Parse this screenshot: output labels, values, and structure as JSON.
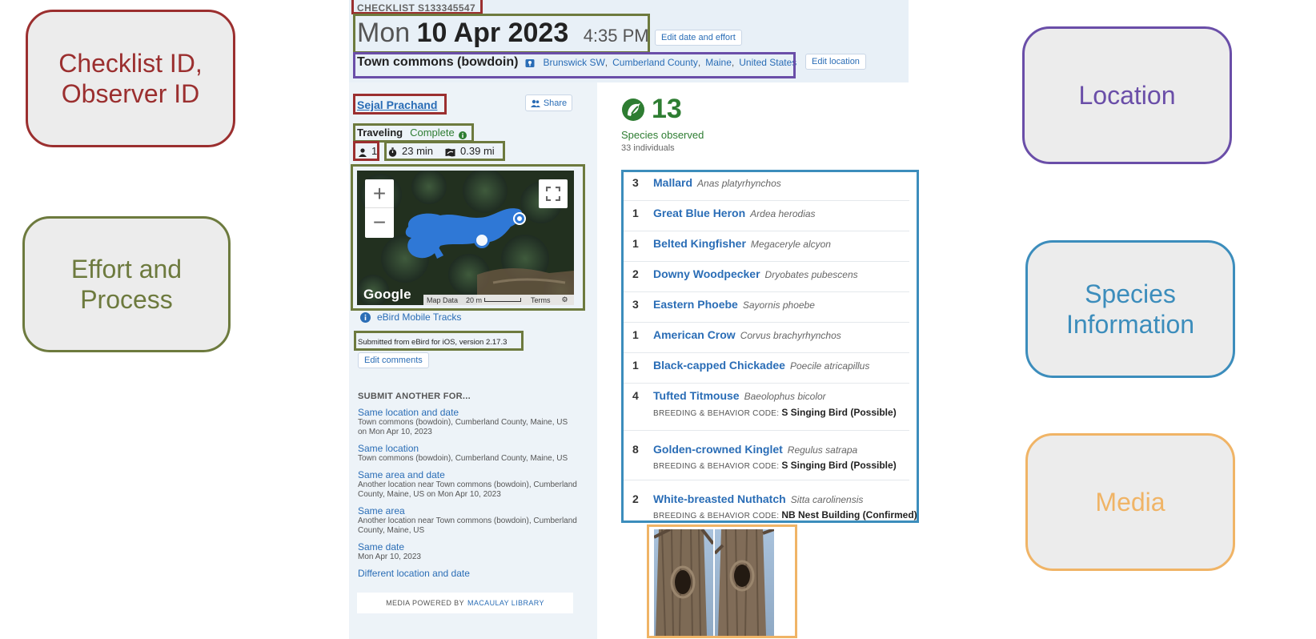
{
  "legend": {
    "checklist": "Checklist ID,\nObserver ID",
    "effort": "Effort and\nProcess",
    "location": "Location",
    "species": "Species\nInformation",
    "media": "Media"
  },
  "header": {
    "checklist_id": "CHECKLIST S133345547",
    "day": "Mon",
    "date": "10 Apr 2023",
    "time": "4:35 PM",
    "edit_date_label": "Edit date and effort",
    "location_name": "Town commons (bowdoin)",
    "location_parts": [
      "Brunswick SW",
      "Cumberland County",
      "Maine",
      "United States"
    ],
    "edit_location_label": "Edit location"
  },
  "sidebar": {
    "observer": "Sejal Prachand",
    "share_label": "Share",
    "protocol": "Traveling",
    "status": "Complete",
    "observers": "1",
    "duration": "23 min",
    "distance": "0.39 mi",
    "map": {
      "attribution": "Google",
      "map_data": "Map Data",
      "scale": "20 m",
      "terms": "Terms",
      "zoom_in": "+",
      "zoom_out": "−"
    },
    "tracks_label": "eBird Mobile Tracks",
    "submitted": "Submitted from eBird for iOS, version 2.17.3",
    "edit_comments_label": "Edit comments",
    "submit_another_title": "SUBMIT ANOTHER FOR...",
    "submit_another": [
      {
        "title": "Same location and date",
        "desc": "Town commons (bowdoin), Cumberland County, Maine, US on Mon Apr 10, 2023"
      },
      {
        "title": "Same location",
        "desc": "Town commons (bowdoin), Cumberland County, Maine, US"
      },
      {
        "title": "Same area and date",
        "desc": "Another location near Town commons (bowdoin), Cumberland County, Maine, US on Mon Apr 10, 2023"
      },
      {
        "title": "Same area",
        "desc": "Another location near Town commons (bowdoin), Cumberland County, Maine, US"
      },
      {
        "title": "Same date",
        "desc": "Mon Apr 10, 2023"
      },
      {
        "title": "Different location and date",
        "desc": ""
      }
    ],
    "media_powered_prefix": "MEDIA POWERED BY",
    "media_powered_link": "MACAULAY LIBRARY"
  },
  "summary": {
    "species_count": "13",
    "species_label": "Species observed",
    "individuals": "33 individuals"
  },
  "species": [
    {
      "count": "3",
      "name": "Mallard",
      "sci": "Anas platyrhynchos",
      "bc_label": "",
      "bc_value": ""
    },
    {
      "count": "1",
      "name": "Great Blue Heron",
      "sci": "Ardea herodias",
      "bc_label": "",
      "bc_value": ""
    },
    {
      "count": "1",
      "name": "Belted Kingfisher",
      "sci": "Megaceryle alcyon",
      "bc_label": "",
      "bc_value": ""
    },
    {
      "count": "2",
      "name": "Downy Woodpecker",
      "sci": "Dryobates pubescens",
      "bc_label": "",
      "bc_value": ""
    },
    {
      "count": "3",
      "name": "Eastern Phoebe",
      "sci": "Sayornis phoebe",
      "bc_label": "",
      "bc_value": ""
    },
    {
      "count": "1",
      "name": "American Crow",
      "sci": "Corvus brachyrhynchos",
      "bc_label": "",
      "bc_value": ""
    },
    {
      "count": "1",
      "name": "Black-capped Chickadee",
      "sci": "Poecile atricapillus",
      "bc_label": "",
      "bc_value": ""
    },
    {
      "count": "4",
      "name": "Tufted Titmouse",
      "sci": "Baeolophus bicolor",
      "bc_label": "BREEDING & BEHAVIOR CODE:",
      "bc_value": "S Singing Bird (Possible)"
    },
    {
      "count": "8",
      "name": "Golden-crowned Kinglet",
      "sci": "Regulus satrapa",
      "bc_label": "BREEDING & BEHAVIOR CODE:",
      "bc_value": "S Singing Bird (Possible)"
    },
    {
      "count": "2",
      "name": "White-breasted Nuthatch",
      "sci": "Sitta carolinensis",
      "bc_label": "BREEDING & BEHAVIOR CODE:",
      "bc_value": "NB Nest Building (Confirmed)"
    }
  ],
  "colors": {
    "red": "#9b2f2f",
    "green": "#6d7a3e",
    "purple": "#6a4ea8",
    "blue": "#3c8dbc",
    "orange": "#f0b466",
    "link": "#2a6db6",
    "species_green": "#2e7d32"
  },
  "icons": {
    "observers": "person-icon",
    "duration": "stopwatch-icon",
    "distance": "route-icon",
    "location": "map-pin-icon",
    "share": "people-icon",
    "info": "info-icon",
    "species": "bird-icon",
    "fullscreen": "fullscreen-icon"
  }
}
